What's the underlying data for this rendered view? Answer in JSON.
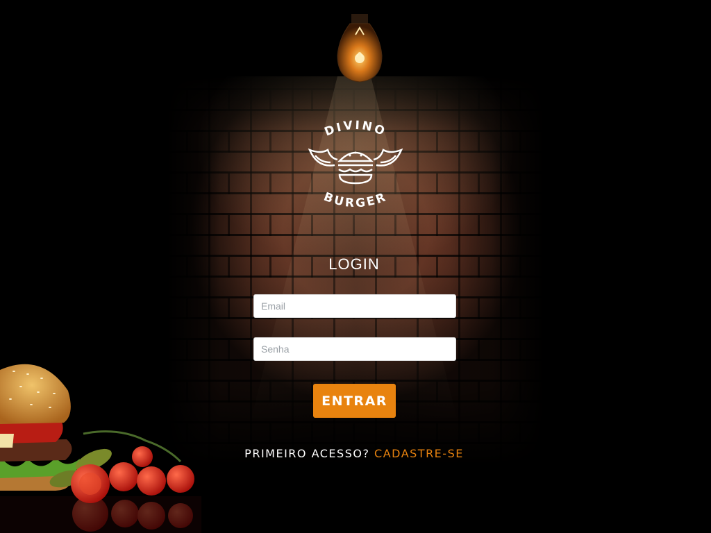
{
  "brand": {
    "top_word": "DIVINO",
    "bottom_word": "BURGER"
  },
  "login": {
    "title": "LOGIN",
    "email_placeholder": "Email",
    "password_placeholder": "Senha",
    "submit_label": "ENTRAR"
  },
  "signup": {
    "prompt": "PRIMEIRO ACESSO?",
    "link_label": "CADASTRE-SE"
  },
  "colors": {
    "accent": "#e8830f",
    "background": "#000000",
    "text": "#ffffff"
  },
  "icons": [
    "light-bulb-icon",
    "winged-burger-logo-icon"
  ]
}
